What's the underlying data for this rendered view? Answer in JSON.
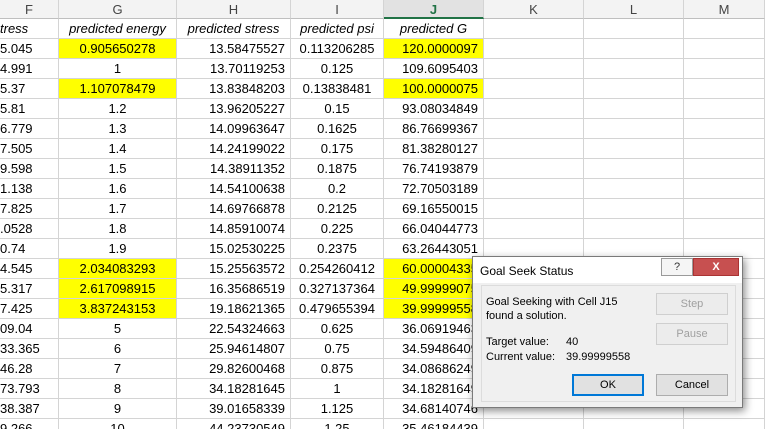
{
  "columns": [
    {
      "letter": "F",
      "header": "tress"
    },
    {
      "letter": "G",
      "header": "predicted energy"
    },
    {
      "letter": "H",
      "header": "predicted stress"
    },
    {
      "letter": "I",
      "header": "predicted psi"
    },
    {
      "letter": "J",
      "header": "predicted G"
    },
    {
      "letter": "K",
      "header": ""
    },
    {
      "letter": "L",
      "header": ""
    },
    {
      "letter": "M",
      "header": ""
    }
  ],
  "selected_column": "J",
  "rows": [
    {
      "F": "5.045",
      "G": "0.905650278",
      "H": "13.58475527",
      "I": "0.113206285",
      "J": "120.0000097",
      "yellow": [
        "G",
        "J"
      ]
    },
    {
      "F": "4.991",
      "G": "1",
      "H": "13.70119253",
      "I": "0.125",
      "J": "109.6095403",
      "yellow": []
    },
    {
      "F": "5.37",
      "G": "1.107078479",
      "H": "13.83848203",
      "I": "0.13838481",
      "J": "100.0000075",
      "yellow": [
        "G",
        "J"
      ]
    },
    {
      "F": "5.81",
      "G": "1.2",
      "H": "13.96205227",
      "I": "0.15",
      "J": "93.08034849",
      "yellow": []
    },
    {
      "F": "6.779",
      "G": "1.3",
      "H": "14.09963647",
      "I": "0.1625",
      "J": "86.76699367",
      "yellow": []
    },
    {
      "F": "7.505",
      "G": "1.4",
      "H": "14.24199022",
      "I": "0.175",
      "J": "81.38280127",
      "yellow": []
    },
    {
      "F": "9.598",
      "G": "1.5",
      "H": "14.38911352",
      "I": "0.1875",
      "J": "76.74193879",
      "yellow": []
    },
    {
      "F": "1.138",
      "G": "1.6",
      "H": "14.54100638",
      "I": "0.2",
      "J": "72.70503189",
      "yellow": []
    },
    {
      "F": "7.825",
      "G": "1.7",
      "H": "14.69766878",
      "I": "0.2125",
      "J": "69.16550015",
      "yellow": []
    },
    {
      "F": ".0528",
      "G": "1.8",
      "H": "14.85910074",
      "I": "0.225",
      "J": "66.04044773",
      "yellow": []
    },
    {
      "F": "0.74",
      "G": "1.9",
      "H": "15.02530225",
      "I": "0.2375",
      "J": "63.26443051",
      "yellow": []
    },
    {
      "F": "4.545",
      "G": "2.034083293",
      "H": "15.25563572",
      "I": "0.254260412",
      "J": "60.00004335",
      "yellow": [
        "G",
        "J"
      ]
    },
    {
      "F": "5.317",
      "G": "2.617098915",
      "H": "16.35686519",
      "I": "0.327137364",
      "J": "49.99999075",
      "yellow": [
        "G",
        "J"
      ]
    },
    {
      "F": "7.425",
      "G": "3.837243153",
      "H": "19.18621365",
      "I": "0.479655394",
      "J": "39.99999558",
      "yellow": [
        "G",
        "J"
      ]
    },
    {
      "F": "09.04",
      "G": "5",
      "H": "22.54324663",
      "I": "0.625",
      "J": "36.06919463",
      "yellow": []
    },
    {
      "F": "33.365",
      "G": "6",
      "H": "25.94614807",
      "I": "0.75",
      "J": "34.59486409",
      "yellow": []
    },
    {
      "F": "46.28",
      "G": "7",
      "H": "29.82600468",
      "I": "0.875",
      "J": "34.08686249",
      "yellow": []
    },
    {
      "F": "73.793",
      "G": "8",
      "H": "34.18281645",
      "I": "1",
      "J": "34.18281649",
      "yellow": []
    },
    {
      "F": "38.387",
      "G": "9",
      "H": "39.01658339",
      "I": "1.125",
      "J": "34.68140746",
      "yellow": []
    },
    {
      "F": "9.266",
      "G": "10",
      "H": "44.23730549",
      "I": "1.25",
      "J": "35.46184439",
      "yellow": []
    }
  ],
  "dialog": {
    "title": "Goal Seek Status",
    "help_label": "?",
    "close_label": "X",
    "message_line1": "Goal Seeking with Cell J15",
    "message_line2": "found a solution.",
    "target_label": "Target value:",
    "target_value": "40",
    "current_label": "Current value:",
    "current_value": "39.99999558",
    "step_label": "Step",
    "pause_label": "Pause",
    "ok_label": "OK",
    "cancel_label": "Cancel"
  }
}
